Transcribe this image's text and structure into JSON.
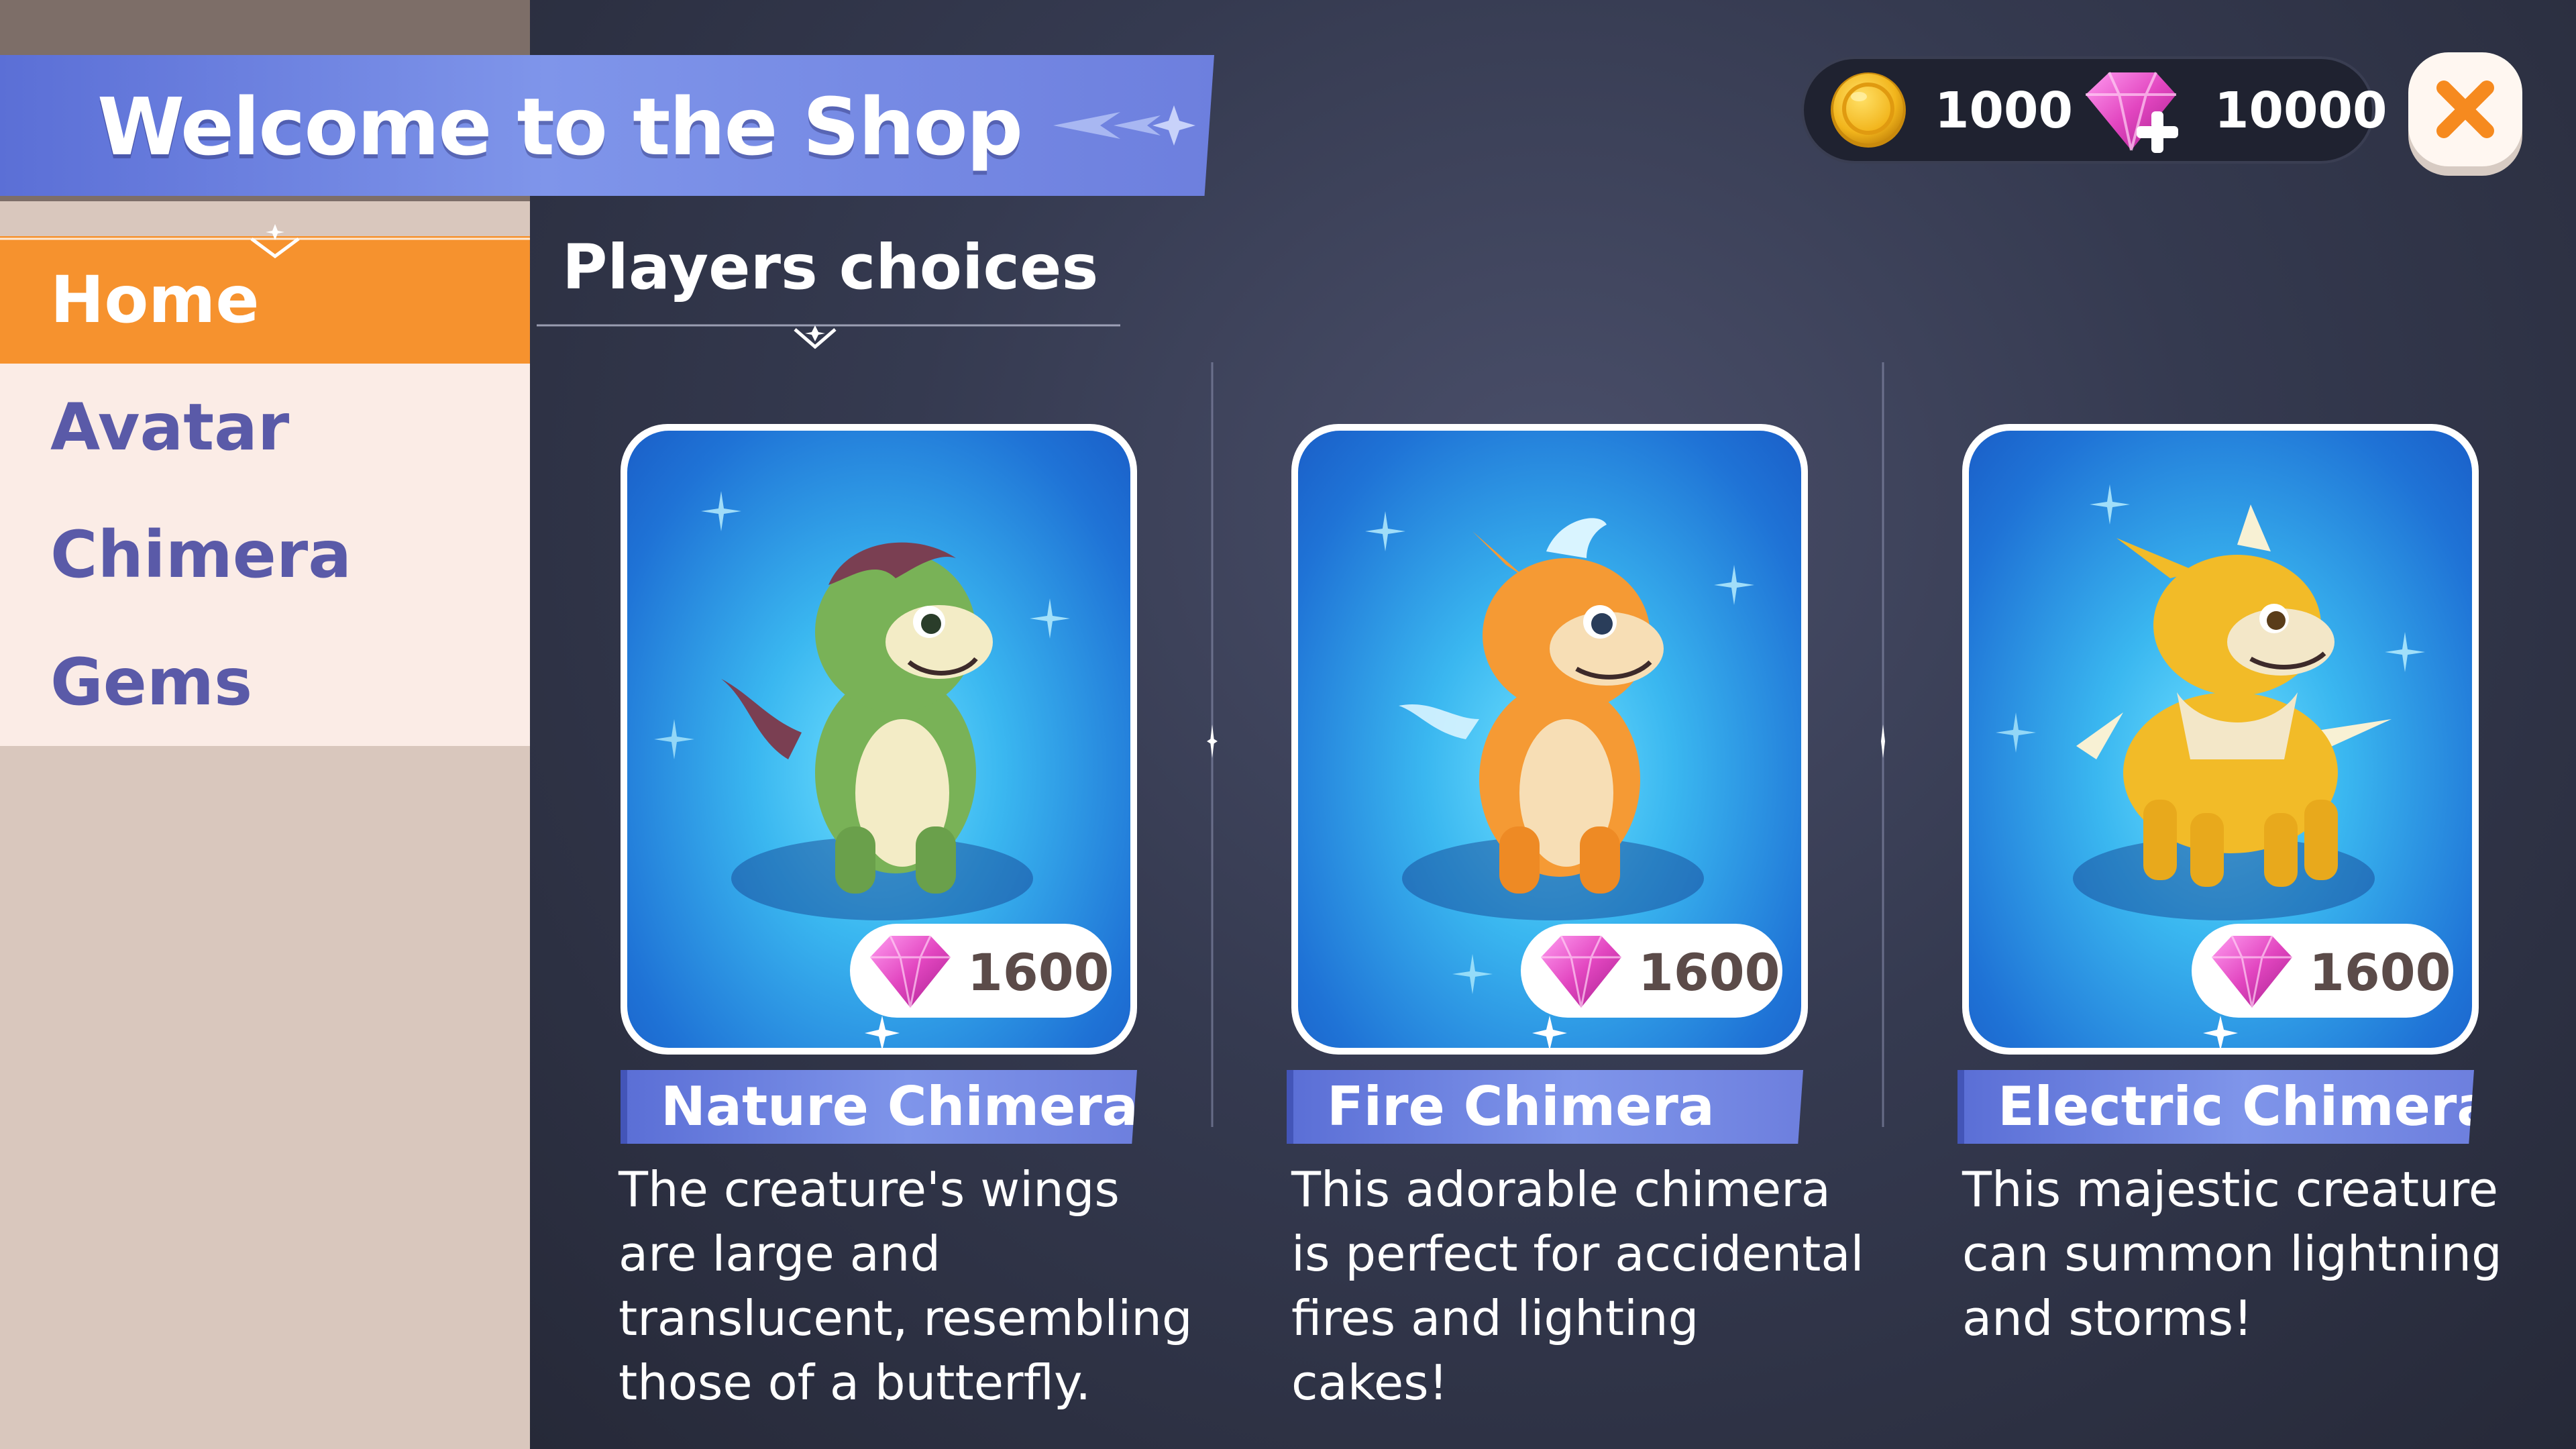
{
  "header": {
    "title": "Welcome to the Shop"
  },
  "currency": {
    "coins": "1000",
    "gems": "10000",
    "coin_icon": "gold-coin-icon",
    "gem_icon": "pink-gem-plus-icon"
  },
  "close_icon": "close-x-icon",
  "nav": {
    "items": [
      {
        "label": "Home",
        "active": true
      },
      {
        "label": "Avatar",
        "active": false
      },
      {
        "label": "Chimera",
        "active": false
      },
      {
        "label": "Gems",
        "active": false
      }
    ]
  },
  "section": {
    "title": "Players choices"
  },
  "cards": [
    {
      "name": "Nature Chimera",
      "price": "1600",
      "creature_color": "#79b257",
      "description": "The creature's wings are large and translucent, resembling those of a butterfly."
    },
    {
      "name": "Fire Chimera",
      "price": "1600",
      "creature_color": "#f59a34",
      "description": "This adorable chimera is perfect for accidental fires and lighting cakes!"
    },
    {
      "name": "Electric Chimera",
      "price": "1600",
      "creature_color": "#f2bb28",
      "description": "This majestic creature can summon lightning and storms!"
    }
  ],
  "colors": {
    "banner": "#6d7fde",
    "active_tab": "#f6922e",
    "nav_text": "#5a5aa8",
    "sidebar_item_bg": "#fbece6",
    "card_bg": "#3ab7f0",
    "gem": "#e246c0",
    "coin": "#f2b51c",
    "close": "#f68a1f"
  }
}
